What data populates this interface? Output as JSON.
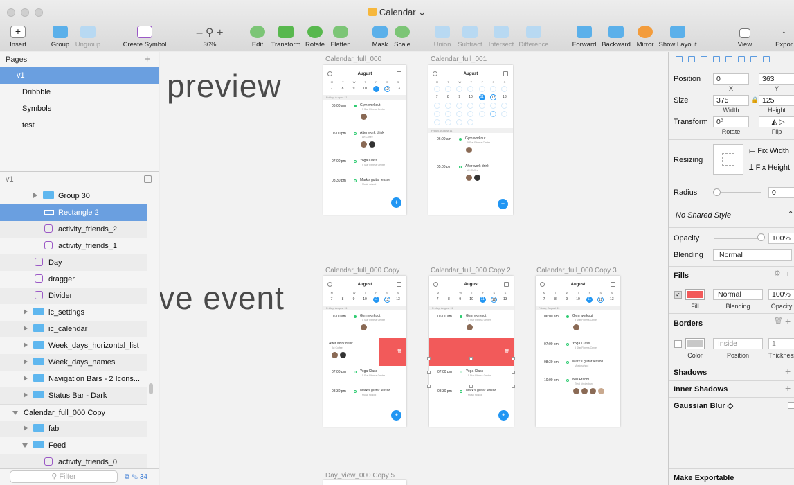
{
  "window": {
    "title": "Calendar"
  },
  "toolbar": {
    "insert": "Insert",
    "group": "Group",
    "ungroup": "Ungroup",
    "create_symbol": "Create Symbol",
    "zoom_minus": "–",
    "zoom_plus": "+",
    "zoom": "36%",
    "edit": "Edit",
    "transform": "Transform",
    "rotate": "Rotate",
    "flatten": "Flatten",
    "mask": "Mask",
    "scale": "Scale",
    "union": "Union",
    "subtract": "Subtract",
    "intersect": "Intersect",
    "difference": "Difference",
    "forward": "Forward",
    "backward": "Backward",
    "mirror": "Mirror",
    "show_layout": "Show Layout",
    "view": "View",
    "export": "Expor"
  },
  "pages": {
    "title": "Pages",
    "add": "+",
    "items": [
      "v1",
      "Dribbble",
      "Symbols",
      "test"
    ]
  },
  "layers": {
    "title": "v1",
    "items": [
      {
        "label": "Group 30",
        "kind": "folder"
      },
      {
        "label": "Rectangle 2",
        "kind": "rect"
      },
      {
        "label": "activity_friends_2",
        "kind": "symbol"
      },
      {
        "label": "activity_friends_1",
        "kind": "symbol"
      },
      {
        "label": "Day",
        "kind": "symbol"
      },
      {
        "label": "dragger",
        "kind": "symbol"
      },
      {
        "label": "Divider",
        "kind": "symbol"
      },
      {
        "label": "ic_settings",
        "kind": "folder"
      },
      {
        "label": "ic_calendar",
        "kind": "folder"
      },
      {
        "label": "Week_days_horizontal_list",
        "kind": "folder"
      },
      {
        "label": "Week_days_names",
        "kind": "folder"
      },
      {
        "label": "Navigation Bars - 2 Icons...",
        "kind": "folder"
      },
      {
        "label": "Status Bar - Dark",
        "kind": "folder"
      },
      {
        "label": "Calendar_full_000 Copy",
        "kind": "artboard"
      },
      {
        "label": "fab",
        "kind": "folder"
      },
      {
        "label": "Feed",
        "kind": "folder"
      },
      {
        "label": "activity_friends_0",
        "kind": "symbol"
      }
    ],
    "filter_placeholder": "Filter",
    "count": "34"
  },
  "canvas": {
    "text1": "preview",
    "text2": "ve event",
    "artboards": [
      "Calendar_full_000",
      "Calendar_full_001",
      "Calendar_full_000 Copy",
      "Calendar_full_000 Copy 2",
      "Calendar_full_000 Copy 3",
      "Day_view_000 Copy 5"
    ],
    "phone": {
      "month": "August",
      "weekdays": [
        "M",
        "T",
        "W",
        "T",
        "F",
        "S",
        "S"
      ],
      "days": [
        "7",
        "8",
        "9",
        "10",
        "11",
        "12",
        "13"
      ],
      "date_sep": "Friday, August 11",
      "events": [
        {
          "time": "06:00 am",
          "name": "Gym workout",
          "place": "5 Star Fitness Center"
        },
        {
          "time": "05:00 pm",
          "name": "After work drink",
          "place": "Art Coffee"
        },
        {
          "time": "07:00 pm",
          "name": "Yoga Class",
          "place": "5 Star Fitness Center"
        },
        {
          "time": "08:30 pm",
          "name": "Mark's guitar lesson",
          "place": "Music school"
        },
        {
          "time": "10:00 pm",
          "name": "Nils Frahm",
          "place": "Tivoli Vredenburg"
        }
      ]
    }
  },
  "inspector": {
    "position": "Position",
    "x_val": "0",
    "y_val": "363",
    "x": "X",
    "y": "Y",
    "size": "Size",
    "w_val": "375",
    "h_val": "125",
    "width": "Width",
    "height": "Height",
    "transform": "Transform",
    "rot_val": "0º",
    "rotate": "Rotate",
    "flip": "Flip",
    "resizing": "Resizing",
    "fix_width": "Fix Width",
    "fix_height": "Fix Height",
    "radius": "Radius",
    "radius_val": "0",
    "shared_style": "No Shared Style",
    "opacity": "Opacity",
    "opacity_val": "100%",
    "blending": "Blending",
    "blending_val": "Normal",
    "fills": "Fills",
    "fill_blend": "Normal",
    "fill_opacity": "100%",
    "fill": "Fill",
    "fill_blending": "Blending",
    "fill_opacity_lbl": "Opacity",
    "borders": "Borders",
    "border_pos": "Inside",
    "border_thick": "1",
    "color": "Color",
    "position_lbl": "Position",
    "thickness": "Thickness",
    "shadows": "Shadows",
    "inner_shadows": "Inner Shadows",
    "gaussian": "Gaussian Blur ◇",
    "make_exportable": "Make Exportable",
    "fill_color": "#f25a5a"
  }
}
